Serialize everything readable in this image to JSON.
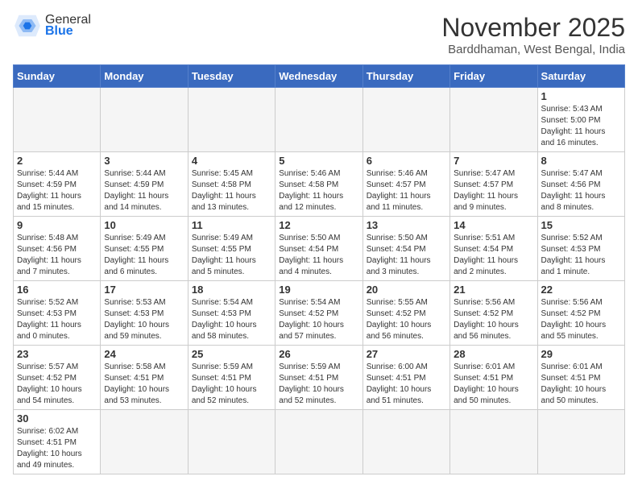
{
  "header": {
    "logo_general": "General",
    "logo_blue": "Blue",
    "title": "November 2025",
    "subtitle": "Barddhaman, West Bengal, India"
  },
  "weekdays": [
    "Sunday",
    "Monday",
    "Tuesday",
    "Wednesday",
    "Thursday",
    "Friday",
    "Saturday"
  ],
  "weeks": [
    [
      {
        "day": "",
        "info": ""
      },
      {
        "day": "",
        "info": ""
      },
      {
        "day": "",
        "info": ""
      },
      {
        "day": "",
        "info": ""
      },
      {
        "day": "",
        "info": ""
      },
      {
        "day": "",
        "info": ""
      },
      {
        "day": "1",
        "info": "Sunrise: 5:43 AM\nSunset: 5:00 PM\nDaylight: 11 hours\nand 16 minutes."
      }
    ],
    [
      {
        "day": "2",
        "info": "Sunrise: 5:44 AM\nSunset: 4:59 PM\nDaylight: 11 hours\nand 15 minutes."
      },
      {
        "day": "3",
        "info": "Sunrise: 5:44 AM\nSunset: 4:59 PM\nDaylight: 11 hours\nand 14 minutes."
      },
      {
        "day": "4",
        "info": "Sunrise: 5:45 AM\nSunset: 4:58 PM\nDaylight: 11 hours\nand 13 minutes."
      },
      {
        "day": "5",
        "info": "Sunrise: 5:46 AM\nSunset: 4:58 PM\nDaylight: 11 hours\nand 12 minutes."
      },
      {
        "day": "6",
        "info": "Sunrise: 5:46 AM\nSunset: 4:57 PM\nDaylight: 11 hours\nand 11 minutes."
      },
      {
        "day": "7",
        "info": "Sunrise: 5:47 AM\nSunset: 4:57 PM\nDaylight: 11 hours\nand 9 minutes."
      },
      {
        "day": "8",
        "info": "Sunrise: 5:47 AM\nSunset: 4:56 PM\nDaylight: 11 hours\nand 8 minutes."
      }
    ],
    [
      {
        "day": "9",
        "info": "Sunrise: 5:48 AM\nSunset: 4:56 PM\nDaylight: 11 hours\nand 7 minutes."
      },
      {
        "day": "10",
        "info": "Sunrise: 5:49 AM\nSunset: 4:55 PM\nDaylight: 11 hours\nand 6 minutes."
      },
      {
        "day": "11",
        "info": "Sunrise: 5:49 AM\nSunset: 4:55 PM\nDaylight: 11 hours\nand 5 minutes."
      },
      {
        "day": "12",
        "info": "Sunrise: 5:50 AM\nSunset: 4:54 PM\nDaylight: 11 hours\nand 4 minutes."
      },
      {
        "day": "13",
        "info": "Sunrise: 5:50 AM\nSunset: 4:54 PM\nDaylight: 11 hours\nand 3 minutes."
      },
      {
        "day": "14",
        "info": "Sunrise: 5:51 AM\nSunset: 4:54 PM\nDaylight: 11 hours\nand 2 minutes."
      },
      {
        "day": "15",
        "info": "Sunrise: 5:52 AM\nSunset: 4:53 PM\nDaylight: 11 hours\nand 1 minute."
      }
    ],
    [
      {
        "day": "16",
        "info": "Sunrise: 5:52 AM\nSunset: 4:53 PM\nDaylight: 11 hours\nand 0 minutes."
      },
      {
        "day": "17",
        "info": "Sunrise: 5:53 AM\nSunset: 4:53 PM\nDaylight: 10 hours\nand 59 minutes."
      },
      {
        "day": "18",
        "info": "Sunrise: 5:54 AM\nSunset: 4:53 PM\nDaylight: 10 hours\nand 58 minutes."
      },
      {
        "day": "19",
        "info": "Sunrise: 5:54 AM\nSunset: 4:52 PM\nDaylight: 10 hours\nand 57 minutes."
      },
      {
        "day": "20",
        "info": "Sunrise: 5:55 AM\nSunset: 4:52 PM\nDaylight: 10 hours\nand 56 minutes."
      },
      {
        "day": "21",
        "info": "Sunrise: 5:56 AM\nSunset: 4:52 PM\nDaylight: 10 hours\nand 56 minutes."
      },
      {
        "day": "22",
        "info": "Sunrise: 5:56 AM\nSunset: 4:52 PM\nDaylight: 10 hours\nand 55 minutes."
      }
    ],
    [
      {
        "day": "23",
        "info": "Sunrise: 5:57 AM\nSunset: 4:52 PM\nDaylight: 10 hours\nand 54 minutes."
      },
      {
        "day": "24",
        "info": "Sunrise: 5:58 AM\nSunset: 4:51 PM\nDaylight: 10 hours\nand 53 minutes."
      },
      {
        "day": "25",
        "info": "Sunrise: 5:59 AM\nSunset: 4:51 PM\nDaylight: 10 hours\nand 52 minutes."
      },
      {
        "day": "26",
        "info": "Sunrise: 5:59 AM\nSunset: 4:51 PM\nDaylight: 10 hours\nand 52 minutes."
      },
      {
        "day": "27",
        "info": "Sunrise: 6:00 AM\nSunset: 4:51 PM\nDaylight: 10 hours\nand 51 minutes."
      },
      {
        "day": "28",
        "info": "Sunrise: 6:01 AM\nSunset: 4:51 PM\nDaylight: 10 hours\nand 50 minutes."
      },
      {
        "day": "29",
        "info": "Sunrise: 6:01 AM\nSunset: 4:51 PM\nDaylight: 10 hours\nand 50 minutes."
      }
    ],
    [
      {
        "day": "30",
        "info": "Sunrise: 6:02 AM\nSunset: 4:51 PM\nDaylight: 10 hours\nand 49 minutes."
      },
      {
        "day": "",
        "info": ""
      },
      {
        "day": "",
        "info": ""
      },
      {
        "day": "",
        "info": ""
      },
      {
        "day": "",
        "info": ""
      },
      {
        "day": "",
        "info": ""
      },
      {
        "day": "",
        "info": ""
      }
    ]
  ]
}
